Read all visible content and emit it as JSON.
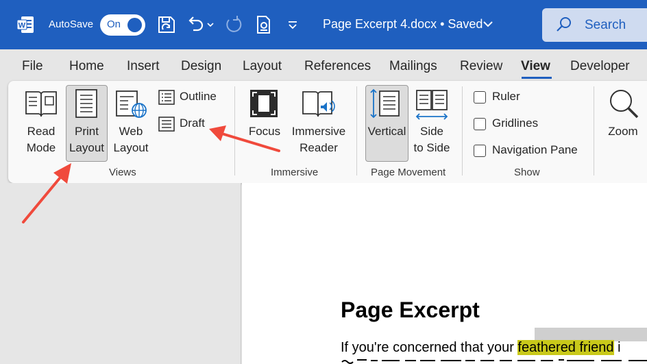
{
  "titlebar": {
    "autosave_label": "AutoSave",
    "autosave_state": "On",
    "document_title": "Page Excerpt 4.docx • Saved",
    "search_label": "Search",
    "icons": [
      "word-logo-icon",
      "save-sync-icon",
      "undo-icon",
      "redo-icon",
      "print-preview-icon",
      "customize-qat-icon"
    ]
  },
  "tabs": [
    "File",
    "Home",
    "Insert",
    "Design",
    "Layout",
    "References",
    "Mailings",
    "Review",
    "View",
    "Developer"
  ],
  "active_tab": "View",
  "ribbon": {
    "views": {
      "group_label": "Views",
      "read_mode": [
        "Read",
        "Mode"
      ],
      "print_layout": [
        "Print",
        "Layout"
      ],
      "web_layout": [
        "Web",
        "Layout"
      ],
      "outline": "Outline",
      "draft": "Draft"
    },
    "immersive": {
      "group_label": "Immersive",
      "focus": "Focus",
      "immersive_reader": [
        "Immersive",
        "Reader"
      ]
    },
    "page_movement": {
      "group_label": "Page Movement",
      "vertical": "Vertical",
      "side_to_side": [
        "Side",
        "to Side"
      ]
    },
    "show": {
      "group_label": "Show",
      "ruler": "Ruler",
      "gridlines": "Gridlines",
      "navigation_pane": "Navigation Pane"
    },
    "zoom": {
      "zoom": "Zoom"
    }
  },
  "document": {
    "heading": "Page Excerpt",
    "line1_before": "If you're concerned that your ",
    "line1_highlight": "feathered friend",
    "line1_after": " i"
  },
  "colors": {
    "titlebar": "#1f5fbf",
    "highlight": "#c9c91a",
    "annotation_arrow": "#f04a3c"
  }
}
